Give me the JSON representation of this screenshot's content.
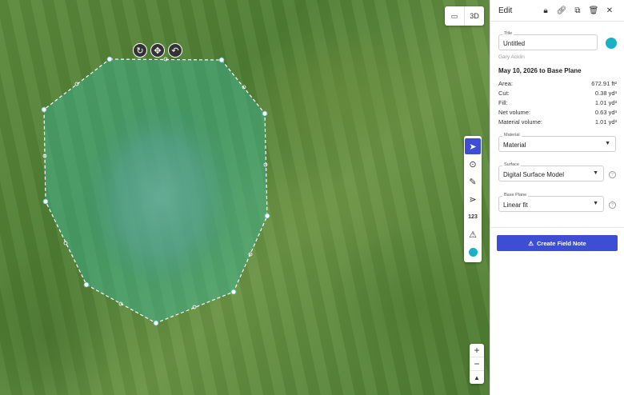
{
  "map": {
    "view_toggle": {
      "map_icon": "map-icon",
      "label_3d": "3D"
    },
    "shape_controls": [
      "rotate-icon",
      "move-icon",
      "undo-icon"
    ],
    "tools": [
      {
        "name": "select",
        "icon": "pointer-icon",
        "glyph": "➤",
        "active": true
      },
      {
        "name": "pin",
        "icon": "location-pin-icon",
        "glyph": "⊙"
      },
      {
        "name": "measure",
        "icon": "ruler-icon",
        "glyph": "✎"
      },
      {
        "name": "path",
        "icon": "path-icon",
        "glyph": "⋗"
      },
      {
        "name": "count",
        "icon": "count-icon",
        "glyph": "123"
      },
      {
        "name": "warning",
        "icon": "warning-icon",
        "glyph": "⚠"
      }
    ],
    "tool_color": "#1ab0c8",
    "zoom": {
      "in": "+",
      "out": "−",
      "compass": "▲"
    }
  },
  "panel": {
    "title": "Edit",
    "header_icons": [
      "lock-icon",
      "link-icon",
      "copy-icon",
      "trash-icon",
      "close-icon"
    ],
    "title_field": {
      "label": "Title",
      "value": "Untitled"
    },
    "color": "#1ab0c8",
    "author": "Gary Acklin",
    "date_line": "May 10, 2026 to Base Plane",
    "stats": [
      {
        "label": "Area:",
        "value": "672.91 ft²"
      },
      {
        "label": "Cut:",
        "value": "0.38 yd³"
      },
      {
        "label": "Fill:",
        "value": "1.01 yd³"
      },
      {
        "label": "Net volume:",
        "value": "0.63 yd³"
      },
      {
        "label": "Material volume:",
        "value": "1.01 yd³"
      }
    ],
    "material": {
      "label": "Material",
      "value": "Material"
    },
    "surface": {
      "label": "Surface",
      "value": "Digital Surface Model"
    },
    "base_plane": {
      "label": "Base Plane",
      "value": "Linear fit"
    },
    "cta_label": "Create Field Note"
  }
}
